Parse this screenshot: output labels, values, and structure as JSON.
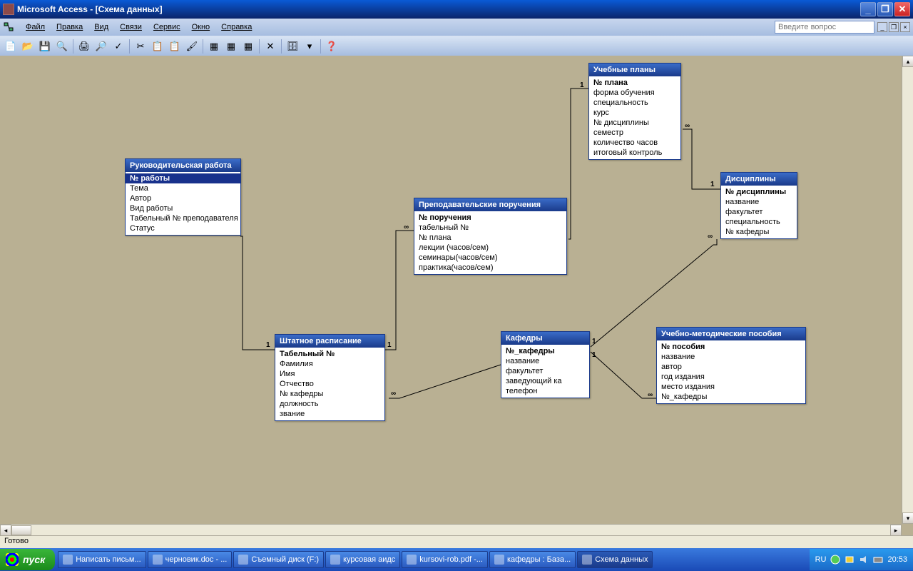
{
  "title": "Microsoft Access - [Схема данных]",
  "menus": [
    "Файл",
    "Правка",
    "Вид",
    "Связи",
    "Сервис",
    "Окно",
    "Справка"
  ],
  "help_placeholder": "Введите вопрос",
  "status": "Готово",
  "tables": {
    "t1": {
      "title": "Руководительская работа",
      "fields": [
        {
          "name": "№ работы",
          "pk": true,
          "sel": true
        },
        {
          "name": "Тема"
        },
        {
          "name": "Автор"
        },
        {
          "name": "Вид работы"
        },
        {
          "name": "Табельный № преподавателя"
        },
        {
          "name": "Статус"
        }
      ]
    },
    "t2": {
      "title": "Штатное расписание",
      "fields": [
        {
          "name": "Табельный №",
          "pk": true
        },
        {
          "name": "Фамилия"
        },
        {
          "name": "Имя"
        },
        {
          "name": "Отчество"
        },
        {
          "name": "№ кафедры"
        },
        {
          "name": "должность"
        },
        {
          "name": "звание"
        }
      ]
    },
    "t3": {
      "title": "Преподавательские поручения",
      "fields": [
        {
          "name": "№ поручения",
          "pk": true
        },
        {
          "name": "табельный №"
        },
        {
          "name": "№ плана"
        },
        {
          "name": "лекции (часов/сем)"
        },
        {
          "name": "семинары(часов/сем)"
        },
        {
          "name": "практика(часов/сем)"
        }
      ]
    },
    "t4": {
      "title": "Учебные планы",
      "fields": [
        {
          "name": "№ плана",
          "pk": true
        },
        {
          "name": "форма обучения"
        },
        {
          "name": "специальность"
        },
        {
          "name": "курс"
        },
        {
          "name": "№ дисциплины"
        },
        {
          "name": "семестр"
        },
        {
          "name": "количество часов"
        },
        {
          "name": "итоговый контроль"
        }
      ]
    },
    "t5": {
      "title": "Дисциплины",
      "fields": [
        {
          "name": "№ дисциплины",
          "pk": true
        },
        {
          "name": "название"
        },
        {
          "name": "факультет"
        },
        {
          "name": "специальность"
        },
        {
          "name": "№ кафедры"
        }
      ]
    },
    "t6": {
      "title": "Кафедры",
      "fields": [
        {
          "name": "№_кафедры",
          "pk": true
        },
        {
          "name": "название"
        },
        {
          "name": "факультет"
        },
        {
          "name": "заведующий ка"
        },
        {
          "name": "телефон"
        }
      ]
    },
    "t7": {
      "title": "Учебно-методические пособия",
      "fields": [
        {
          "name": "№ пособия",
          "pk": true
        },
        {
          "name": "название"
        },
        {
          "name": "автор"
        },
        {
          "name": "год издания"
        },
        {
          "name": "место издания"
        },
        {
          "name": "№_кафедры"
        }
      ]
    }
  },
  "relationships": [
    {
      "from": "t2",
      "to": "t1",
      "card_from": "1",
      "card_to": "∞"
    },
    {
      "from": "t2",
      "to": "t3",
      "card_from": "1",
      "card_to": "∞"
    },
    {
      "from": "t4",
      "to": "t3",
      "card_from": "1",
      "card_to": "∞"
    },
    {
      "from": "t5",
      "to": "t4",
      "card_from": "1",
      "card_to": "∞"
    },
    {
      "from": "t6",
      "to": "t2",
      "card_from": "1",
      "card_to": "∞"
    },
    {
      "from": "t6",
      "to": "t5",
      "card_from": "1",
      "card_to": "∞"
    },
    {
      "from": "t6",
      "to": "t7",
      "card_from": "1",
      "card_to": "∞"
    }
  ],
  "taskbar": {
    "start": "пуск",
    "items": [
      {
        "label": "Написать письм..."
      },
      {
        "label": "черновик.doc - ..."
      },
      {
        "label": "Съемный диск (F:)"
      },
      {
        "label": "курсовая аидс"
      },
      {
        "label": "kursovi-rob.pdf -..."
      },
      {
        "label": "кафедры : База..."
      },
      {
        "label": "Схема данных",
        "active": true
      }
    ],
    "lang": "RU",
    "time": "20:53"
  }
}
